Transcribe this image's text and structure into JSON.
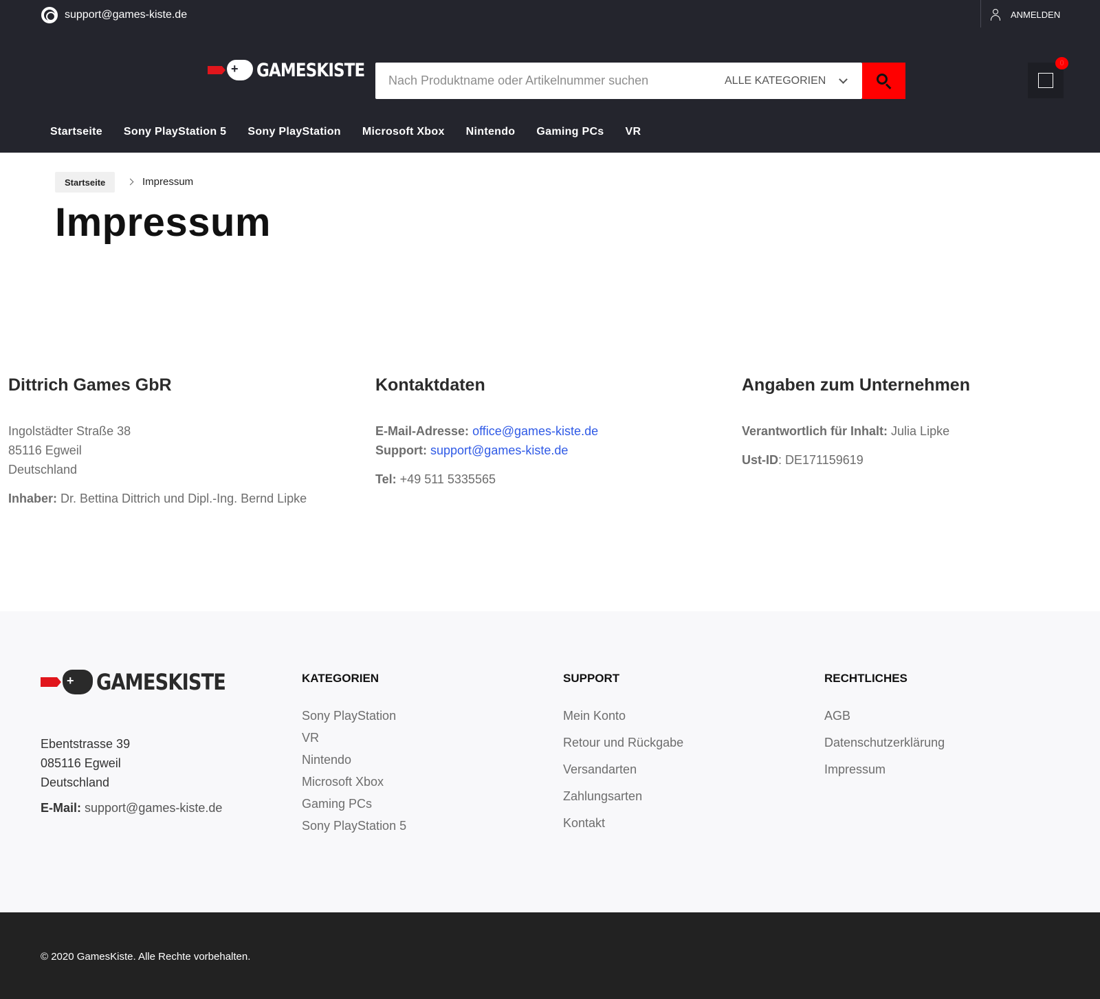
{
  "header": {
    "support_email": "support@games-kiste.de",
    "login_label": "ANMELDEN",
    "logo_text": "GAMESKISTE",
    "search": {
      "placeholder": "Nach Produktname oder Artikelnummer suchen",
      "category": "ALLE KATEGORIEN"
    },
    "cart_count": "0",
    "nav": [
      "Startseite",
      "Sony PlayStation 5",
      "Sony PlayStation",
      "Microsoft Xbox",
      "Nintendo",
      "Gaming PCs",
      "VR"
    ]
  },
  "breadcrumb": {
    "home": "Startseite",
    "current": "Impressum"
  },
  "page_title": "Impressum",
  "company": {
    "heading": "Dittrich Games GbR",
    "street": "Ingolstädter Straße 38",
    "city": "85116 Egweil",
    "country": "Deutschland",
    "owner_label": "Inhaber:",
    "owner": " Dr. Bettina Dittrich und Dipl.-Ing. Bernd Lipke"
  },
  "contact": {
    "heading": "Kontaktdaten",
    "email_label": "E-Mail-Adresse:",
    "email": "office@games-kiste.de",
    "support_label": "Support:",
    "support": "support@games-kiste.de",
    "tel_label": "Tel:",
    "tel": " +49 511 5335565"
  },
  "company_info": {
    "heading": "Angaben zum Unternehmen",
    "responsible_label": "Verantwortlich für Inhalt:",
    "responsible": " Julia Lipke",
    "vat_label": "Ust-ID",
    "vat": ": DE171159619"
  },
  "footer": {
    "logo_text": "GAMESKISTE",
    "street": "Ebentstrasse 39",
    "city": "085116 Egweil",
    "country": "Deutschland",
    "email_label": "E-Mail:",
    "email": " support@games-kiste.de",
    "categories": {
      "heading": "KATEGORIEN",
      "items": [
        "Sony PlayStation",
        "VR",
        "Nintendo",
        "Microsoft Xbox",
        "Gaming PCs",
        "Sony PlayStation 5"
      ]
    },
    "support": {
      "heading": "SUPPORT",
      "items": [
        "Mein Konto",
        "Retour und Rückgabe",
        "Versandarten",
        "Zahlungsarten",
        "Kontakt"
      ]
    },
    "legal": {
      "heading": "RECHTLICHES",
      "items": [
        "AGB",
        "Datenschutzerklärung",
        "Impressum"
      ]
    },
    "copyright": "© 2020 GamesKiste. Alle Rechte vorbehalten."
  },
  "colors": {
    "header_bg": "#24252d",
    "accent": "#ff0000",
    "link": "#2f5ae6",
    "footer_bg": "#f8f8fa",
    "bottom_bg": "#222222"
  },
  "icons": {
    "support": "lifebuoy-icon",
    "login": "user-icon",
    "search": "search-icon",
    "cart": "cart-icon",
    "breadcrumb_sep": "chevron-right-icon",
    "dropdown": "chevron-down-icon"
  }
}
